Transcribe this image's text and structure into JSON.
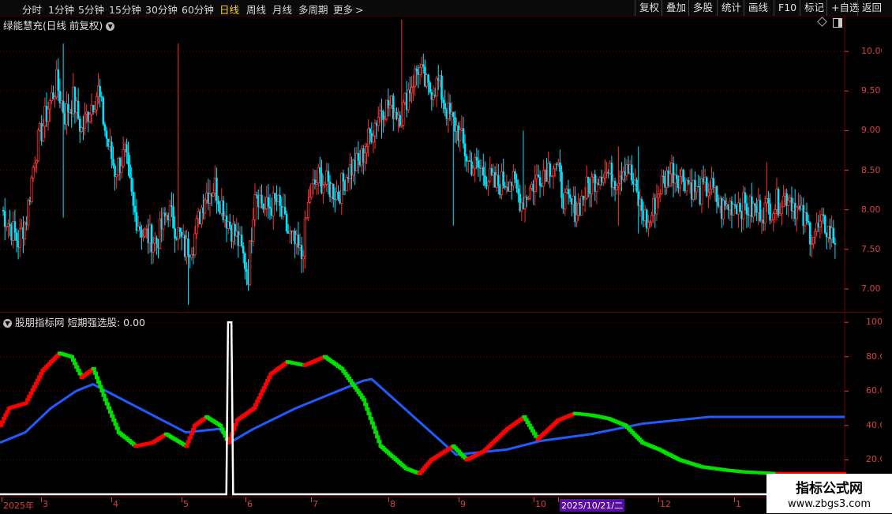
{
  "toolbar": {
    "periods": [
      "分时",
      "1分钟",
      "5分钟",
      "15分钟",
      "30分钟",
      "60分钟",
      "日线",
      "周线",
      "月线",
      "多周期",
      "更多"
    ],
    "active_period": "日线",
    "more_arrow": ">",
    "right_buttons": [
      "复权",
      "叠加",
      "多股",
      "统计",
      "画线",
      "F10",
      "标记",
      "+自选",
      "返回"
    ]
  },
  "main_panel": {
    "title": "绿能慧充(日线 前复权)",
    "price_axis": [
      "10.00",
      "9.50",
      "9.00",
      "8.50",
      "8.00",
      "7.50",
      "7.00"
    ]
  },
  "indicator_panel": {
    "title": "股朋指标网 短期强选股: 0.00",
    "axis": [
      "100.0",
      "80.00",
      "60.00",
      "40.00",
      "20.00"
    ]
  },
  "date_axis": {
    "labels": [
      "2025年",
      "3",
      "4",
      "5",
      "6",
      "7",
      "8",
      "9",
      "10",
      "2025/10/21/二",
      "12",
      "1"
    ],
    "highlight": "2025/10/21/二"
  },
  "watermark": {
    "line1": "指标公式网",
    "line2": "www.zbgs3.com"
  },
  "colors": {
    "up": "#ff3030",
    "down": "#00e5ff",
    "ind_red": "#ff0000",
    "ind_green": "#00e000",
    "ind_blue": "#1e5cff",
    "grid": "#6a0000",
    "active_tab": "#ffd700"
  },
  "chart_data": [
    {
      "type": "candlestick",
      "title": "绿能慧充(日线 前复权)",
      "y_ticks": [
        10.0,
        9.5,
        9.0,
        8.5,
        8.0,
        7.5,
        7.0
      ],
      "ylim": [
        6.7,
        10.45
      ],
      "close_anchors": [
        [
          0,
          8.0
        ],
        [
          5,
          7.8
        ],
        [
          10,
          7.6
        ],
        [
          15,
          7.9
        ],
        [
          20,
          8.7
        ],
        [
          28,
          9.3
        ],
        [
          33,
          9.6
        ],
        [
          38,
          9.2
        ],
        [
          43,
          9.4
        ],
        [
          48,
          9.0
        ],
        [
          53,
          9.3
        ],
        [
          58,
          9.5
        ],
        [
          63,
          8.9
        ],
        [
          68,
          8.5
        ],
        [
          74,
          8.7
        ],
        [
          79,
          8.0
        ],
        [
          85,
          7.7
        ],
        [
          93,
          7.6
        ],
        [
          100,
          8.0
        ],
        [
          110,
          7.5
        ],
        [
          115,
          7.6
        ],
        [
          122,
          8.2
        ],
        [
          128,
          8.3
        ],
        [
          135,
          7.9
        ],
        [
          142,
          7.6
        ],
        [
          148,
          7.2
        ],
        [
          152,
          8.3
        ],
        [
          158,
          8.0
        ],
        [
          165,
          8.1
        ],
        [
          172,
          7.7
        ],
        [
          180,
          7.4
        ],
        [
          185,
          8.2
        ],
        [
          190,
          8.4
        ],
        [
          196,
          8.3
        ],
        [
          202,
          8.2
        ],
        [
          208,
          8.5
        ],
        [
          215,
          8.6
        ],
        [
          222,
          9.0
        ],
        [
          228,
          9.3
        ],
        [
          234,
          9.3
        ],
        [
          240,
          9.2
        ],
        [
          244,
          9.5
        ],
        [
          250,
          9.8
        ],
        [
          256,
          9.5
        ],
        [
          262,
          9.6
        ],
        [
          268,
          9.2
        ],
        [
          274,
          9.0
        ],
        [
          280,
          8.6
        ],
        [
          288,
          8.5
        ],
        [
          296,
          8.3
        ],
        [
          305,
          8.4
        ],
        [
          312,
          8.1
        ],
        [
          318,
          8.3
        ],
        [
          325,
          8.5
        ],
        [
          332,
          8.6
        ],
        [
          338,
          8.1
        ],
        [
          345,
          8.0
        ],
        [
          352,
          8.3
        ],
        [
          360,
          8.5
        ],
        [
          368,
          8.4
        ],
        [
          375,
          8.6
        ],
        [
          382,
          8.1
        ],
        [
          388,
          7.8
        ],
        [
          395,
          8.3
        ],
        [
          402,
          8.5
        ],
        [
          410,
          8.4
        ],
        [
          418,
          8.2
        ],
        [
          425,
          8.3
        ],
        [
          432,
          8.0
        ],
        [
          440,
          8.1
        ],
        [
          450,
          8.0
        ],
        [
          458,
          8.0
        ],
        [
          466,
          8.1
        ],
        [
          472,
          8.2
        ],
        [
          480,
          7.9
        ],
        [
          486,
          7.7
        ],
        [
          494,
          7.8
        ],
        [
          500,
          7.6
        ]
      ],
      "spikes": [
        [
          37,
          10.1,
          7.9
        ],
        [
          106,
          10.1,
          8.0
        ],
        [
          112,
          7.2,
          6.8
        ],
        [
          228,
          9.4,
          8.9
        ],
        [
          240,
          10.4,
          9.2
        ],
        [
          271,
          8.8,
          7.8
        ],
        [
          313,
          9.0,
          8.4
        ],
        [
          370,
          8.8,
          7.8
        ],
        [
          382,
          8.8,
          7.7
        ],
        [
          459,
          8.6,
          8.0
        ]
      ]
    },
    {
      "type": "line",
      "title": "股朋指标网 短期强选股: 0.00",
      "y_ticks": [
        100,
        80,
        60,
        40,
        20
      ],
      "ylim": [
        0,
        101
      ],
      "series": [
        {
          "name": "",
          "role": "signal",
          "points": [
            [
              0,
              0
            ],
            [
              134,
              0
            ],
            [
              135,
              100
            ],
            [
              137,
              100
            ],
            [
              138,
              0
            ],
            [
              500,
              0
            ]
          ]
        },
        {
          "name": "",
          "role": "long",
          "points": [
            [
              0,
              30
            ],
            [
              15,
              36
            ],
            [
              30,
              50
            ],
            [
              45,
              60
            ],
            [
              55,
              64
            ],
            [
              110,
              36
            ],
            [
              130,
              38
            ],
            [
              136,
              30
            ],
            [
              150,
              38
            ],
            [
              175,
              50
            ],
            [
              200,
              60
            ],
            [
              215,
              66
            ],
            [
              220,
              67
            ],
            [
              270,
              23
            ],
            [
              300,
              26
            ],
            [
              320,
              31
            ],
            [
              350,
              35
            ],
            [
              380,
              41
            ],
            [
              400,
              43
            ],
            [
              420,
              45
            ],
            [
              500,
              45
            ]
          ]
        },
        {
          "name": "",
          "role": "short",
          "points": [
            [
              0,
              40
            ],
            [
              5,
              50
            ],
            [
              15,
              53
            ],
            [
              25,
              72
            ],
            [
              35,
              82
            ],
            [
              42,
              80
            ],
            [
              48,
              68
            ],
            [
              55,
              73
            ],
            [
              62,
              55
            ],
            [
              70,
              36
            ],
            [
              80,
              28
            ],
            [
              90,
              30
            ],
            [
              98,
              35
            ],
            [
              110,
              28
            ],
            [
              115,
              40
            ],
            [
              122,
              45
            ],
            [
              130,
              40
            ],
            [
              135,
              30
            ],
            [
              140,
              43
            ],
            [
              150,
              50
            ],
            [
              160,
              70
            ],
            [
              170,
              77
            ],
            [
              180,
              75
            ],
            [
              192,
              80
            ],
            [
              202,
              73
            ],
            [
              215,
              55
            ],
            [
              225,
              28
            ],
            [
              240,
              15
            ],
            [
              248,
              12
            ],
            [
              255,
              20
            ],
            [
              268,
              28
            ],
            [
              276,
              20
            ],
            [
              286,
              25
            ],
            [
              300,
              38
            ],
            [
              310,
              45
            ],
            [
              318,
              32
            ],
            [
              330,
              43
            ],
            [
              340,
              47
            ],
            [
              350,
              46
            ],
            [
              360,
              44
            ],
            [
              370,
              40
            ],
            [
              380,
              30
            ],
            [
              390,
              26
            ],
            [
              402,
              20
            ],
            [
              415,
              16
            ],
            [
              430,
              14
            ],
            [
              440,
              13
            ],
            [
              460,
              12
            ],
            [
              500,
              12
            ]
          ]
        }
      ]
    }
  ]
}
